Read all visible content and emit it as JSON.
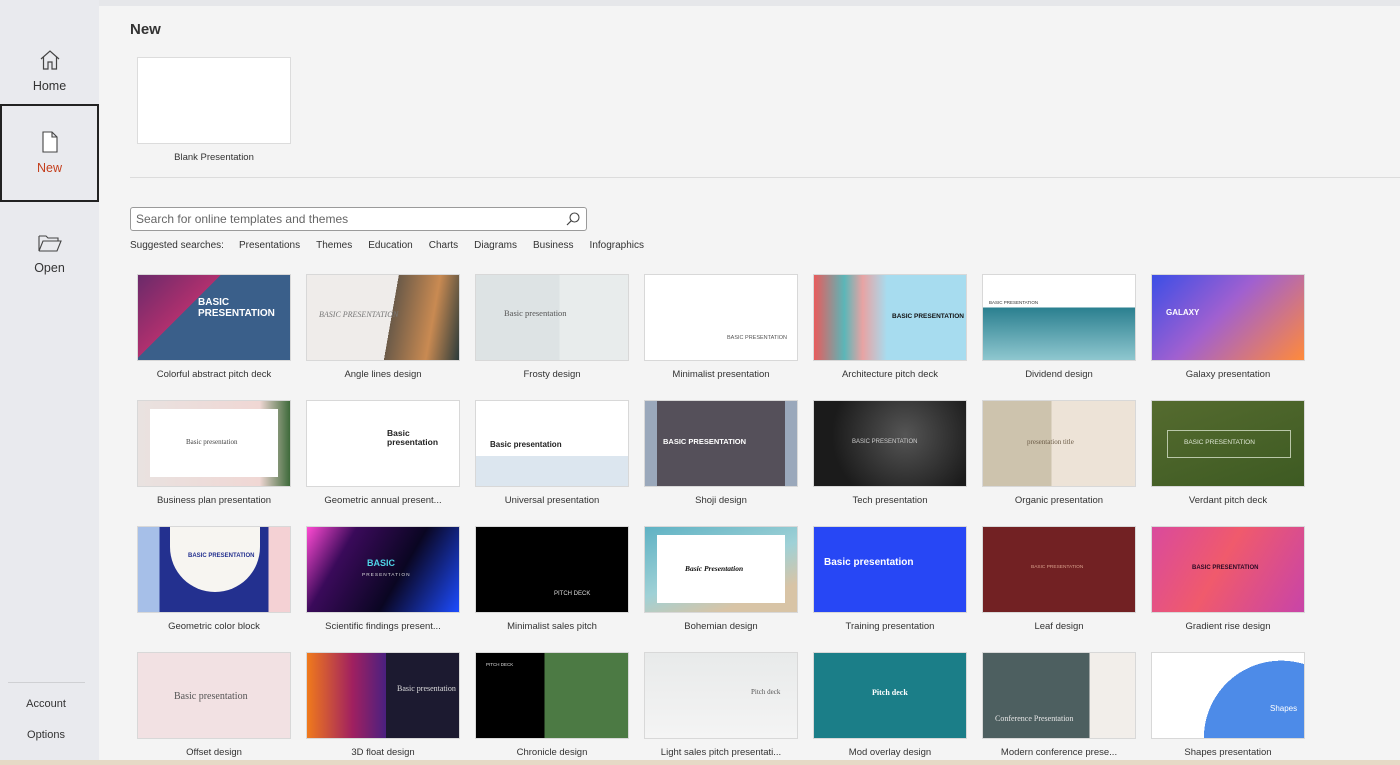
{
  "sidebar": {
    "items": [
      {
        "label": "Home",
        "icon": "home-icon"
      },
      {
        "label": "New",
        "icon": "new-document-icon",
        "active": true
      },
      {
        "label": "Open",
        "icon": "folder-open-icon"
      }
    ],
    "bottom": {
      "account": "Account",
      "options": "Options"
    },
    "active_color": "#c43e1c"
  },
  "main": {
    "title": "New",
    "blank": {
      "label": "Blank Presentation"
    },
    "search": {
      "placeholder": "Search for online templates and themes",
      "value": ""
    },
    "suggested": {
      "label": "Suggested searches:",
      "items": [
        "Presentations",
        "Themes",
        "Education",
        "Charts",
        "Diagrams",
        "Business",
        "Infographics"
      ]
    },
    "templates": [
      {
        "name": "Colorful abstract pitch deck",
        "thumb_text": "BASIC PRESENTATION"
      },
      {
        "name": "Angle lines design",
        "thumb_text": "BASIC PRESENTATION"
      },
      {
        "name": "Frosty design",
        "thumb_text": "Basic presentation"
      },
      {
        "name": "Minimalist presentation",
        "thumb_text": "BASIC PRESENTATION"
      },
      {
        "name": "Architecture pitch deck",
        "thumb_text": "BASIC PRESENTATION"
      },
      {
        "name": "Dividend design",
        "thumb_text": "BASIC PRESENTATION"
      },
      {
        "name": "Galaxy presentation",
        "thumb_text": "GALAXY"
      },
      {
        "name": "Business plan presentation",
        "thumb_text": "Basic presentation"
      },
      {
        "name": "Geometric annual present...",
        "thumb_text": "Basic presentation"
      },
      {
        "name": "Universal presentation",
        "thumb_text": "Basic presentation"
      },
      {
        "name": "Shoji design",
        "thumb_text": "BASIC PRESENTATION"
      },
      {
        "name": "Tech presentation",
        "thumb_text": "BASIC PRESENTATION"
      },
      {
        "name": "Organic presentation",
        "thumb_text": "presentation title"
      },
      {
        "name": "Verdant pitch deck",
        "thumb_text": "BASIC PRESENTATION"
      },
      {
        "name": "Geometric color block",
        "thumb_text": "BASIC PRESENTATION"
      },
      {
        "name": "Scientific findings present...",
        "thumb_text": "BASIC",
        "thumb_sub": "PRESENTATION"
      },
      {
        "name": "Minimalist sales pitch",
        "thumb_text": "PITCH DECK"
      },
      {
        "name": "Bohemian design",
        "thumb_text": "Basic Presentation"
      },
      {
        "name": "Training presentation",
        "thumb_text": "Basic presentation"
      },
      {
        "name": "Leaf design",
        "thumb_text": "BASIC PRESENTATION"
      },
      {
        "name": "Gradient rise design",
        "thumb_text": "BASIC PRESENTATION"
      },
      {
        "name": "Offset design",
        "thumb_text": "Basic presentation"
      },
      {
        "name": "3D float design",
        "thumb_text": "Basic presentation"
      },
      {
        "name": "Chronicle design",
        "thumb_text": "PITCH DECK"
      },
      {
        "name": "Light sales pitch presentati...",
        "thumb_text": "Pitch deck"
      },
      {
        "name": "Mod overlay design",
        "thumb_text": "Pitch deck"
      },
      {
        "name": "Modern conference prese...",
        "thumb_text": "Conference Presentation"
      },
      {
        "name": "Shapes presentation",
        "thumb_text": "Shapes"
      }
    ]
  }
}
